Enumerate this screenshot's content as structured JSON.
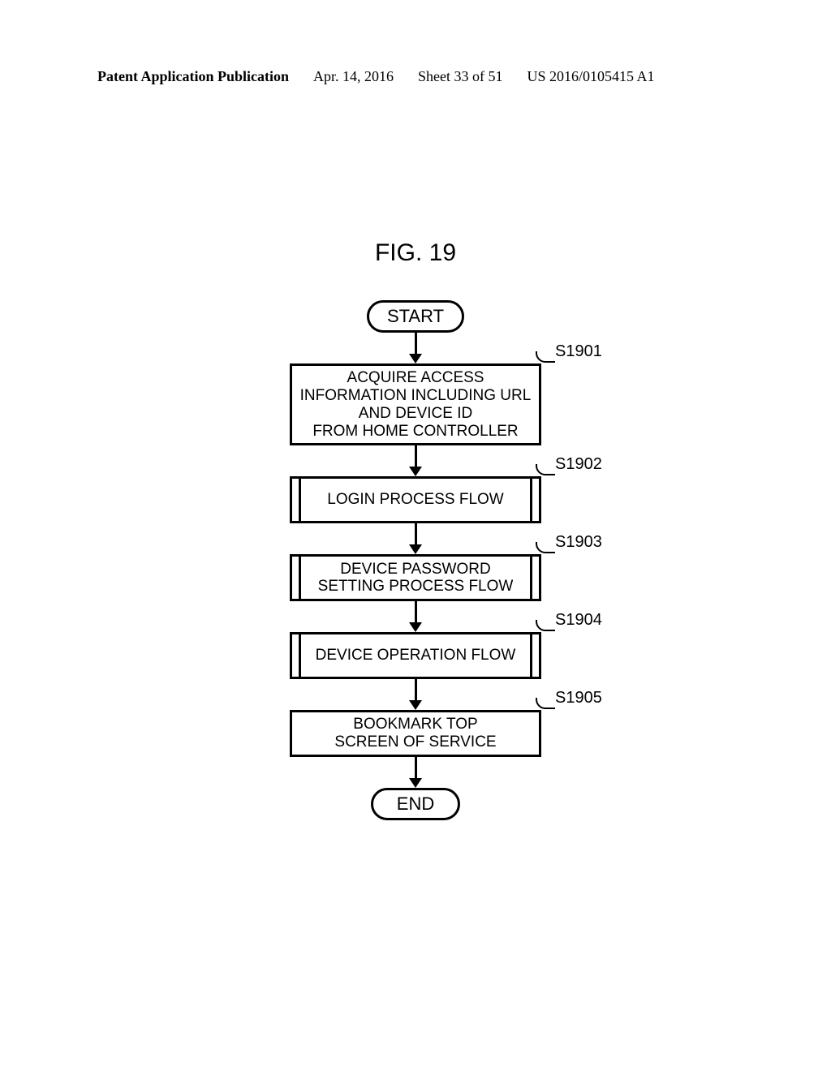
{
  "header": {
    "left": "Patent Application Publication",
    "date": "Apr. 14, 2016",
    "sheet": "Sheet 33 of 51",
    "pubnum": "US 2016/0105415 A1"
  },
  "figure": {
    "title": "FIG. 19",
    "start": "START",
    "end": "END",
    "steps": [
      {
        "label": "S1901",
        "text": "ACQUIRE ACCESS\nINFORMATION INCLUDING URL\nAND DEVICE ID\nFROM HOME CONTROLLER",
        "type": "process"
      },
      {
        "label": "S1902",
        "text": "LOGIN PROCESS FLOW",
        "type": "subprocess"
      },
      {
        "label": "S1903",
        "text": "DEVICE PASSWORD\nSETTING PROCESS FLOW",
        "type": "subprocess"
      },
      {
        "label": "S1904",
        "text": "DEVICE OPERATION FLOW",
        "type": "subprocess"
      },
      {
        "label": "S1905",
        "text": "BOOKMARK TOP\nSCREEN OF SERVICE",
        "type": "process"
      }
    ]
  }
}
